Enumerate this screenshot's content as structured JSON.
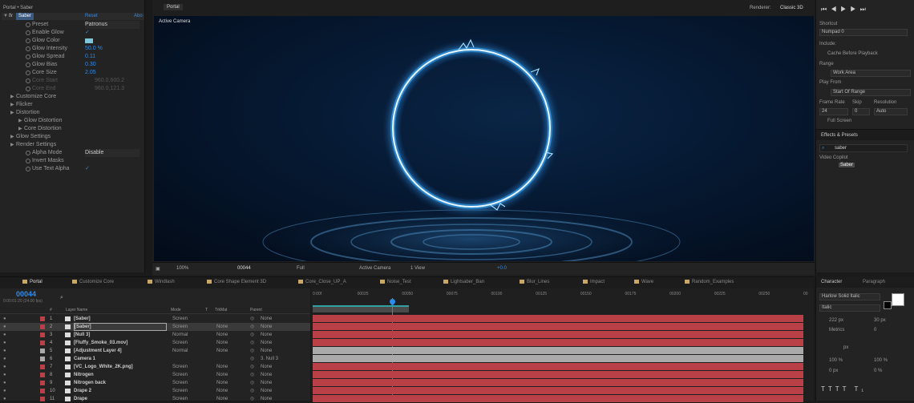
{
  "effect_controls": {
    "title": "Portal • Saber",
    "effect_name": "Saber",
    "reset": "Reset",
    "about": "Abo",
    "rows": [
      {
        "label": "Preset",
        "value": "Patronus",
        "kind": "dropdown"
      },
      {
        "label": "Enable Glow",
        "value": "✓"
      },
      {
        "label": "Glow Color",
        "value": ""
      },
      {
        "label": "Glow Intensity",
        "value": "50.0 %"
      },
      {
        "label": "Glow Spread",
        "value": "0.11"
      },
      {
        "label": "Glow Bias",
        "value": "0.30"
      },
      {
        "label": "Core Size",
        "value": "2.05"
      },
      {
        "label": "Core Start",
        "value": "960.0,600.2",
        "disabled": true
      },
      {
        "label": "Core End",
        "value": "960.0,121.3",
        "disabled": true
      },
      {
        "label": "Customize Core",
        "value": ""
      },
      {
        "label": "Flicker",
        "value": ""
      },
      {
        "label": "Distortion",
        "value": ""
      },
      {
        "label": "Glow Distortion",
        "value": ""
      },
      {
        "label": "Core Distortion",
        "value": ""
      },
      {
        "label": "Glow Settings",
        "value": ""
      },
      {
        "label": "Render Settings",
        "value": ""
      },
      {
        "label": "Alpha Mode",
        "value": "Disable",
        "kind": "dropdown"
      },
      {
        "label": "Invert Masks",
        "value": ""
      },
      {
        "label": "Use Text Alpha",
        "value": "✓"
      }
    ]
  },
  "viewer": {
    "tab": "Portal",
    "renderer_label": "Renderer:",
    "renderer_value": "Classic 3D",
    "camera_label": "Active Camera",
    "bottom_bar": {
      "zoom": "100%",
      "timecode": "00044",
      "resolution": "Full",
      "camera": "Active Camera",
      "views": "1 View",
      "exposure": "+0.0"
    }
  },
  "preview": {
    "shortcut_label": "Shortcut",
    "shortcut_value": "Numpad 0",
    "include_label": "Include:",
    "cache_label": "Cache Before Playback",
    "range_label": "Range",
    "range_value": "Work Area",
    "playfrom_label": "Play From",
    "playfrom_value": "Start Of Range",
    "framerate_label": "Frame Rate",
    "skip_label": "Skip",
    "resolution_label": "Resolution",
    "framerate_value": "24",
    "skip_value": "0",
    "resolution_value": "Auto",
    "fullscreen_label": "Full Screen"
  },
  "effects_presets": {
    "title": "Effects & Presets",
    "search": "saber",
    "category": "Video Copilot",
    "item": "Saber"
  },
  "comp_tabs": [
    "Portal",
    "Customize Core",
    "Windlash",
    "Core Shape Element 3D",
    "Core_Close_UP_A",
    "Noise_Test",
    "Lightsaber_Ban",
    "Blur_Lines",
    "Impact",
    "Wave",
    "Random_Examples"
  ],
  "timeline": {
    "timecode": "00044",
    "timecode_sub": "0:00:01:20 (24.00 fps)",
    "headers": {
      "num": "#",
      "layer_name": "Layer Name",
      "mode": "Mode",
      "t": "T",
      "trkmat": "TrkMat",
      "parent": "Parent"
    },
    "ruler": [
      "0:00f",
      "00025",
      "00050",
      "00075",
      "00100",
      "00125",
      "00150",
      "00175",
      "00200",
      "00225",
      "00250",
      "00"
    ],
    "layers": [
      {
        "num": "1",
        "name": "[Saber]",
        "mode": "Screen",
        "trkmat": "",
        "parent": "None",
        "color": "#b94046"
      },
      {
        "num": "2",
        "name": "[Saber]",
        "mode": "Screen",
        "trkmat": "None",
        "parent": "None",
        "color": "#b94046",
        "selected": true
      },
      {
        "num": "3",
        "name": "[Null 3]",
        "mode": "Normal",
        "trkmat": "None",
        "parent": "None",
        "color": "#b94046"
      },
      {
        "num": "4",
        "name": "[Fluffy_Smoke_03.mov]",
        "mode": "Screen",
        "trkmat": "None",
        "parent": "None",
        "color": "#b94046"
      },
      {
        "num": "5",
        "name": "[Adjustment Layer 4]",
        "mode": "Normal",
        "trkmat": "None",
        "parent": "None",
        "color": "#aaaaaa"
      },
      {
        "num": "6",
        "name": "Camera 1",
        "mode": "",
        "trkmat": "",
        "parent": "3. Null 3",
        "color": "#aaaaaa"
      },
      {
        "num": "7",
        "name": "[VC_Logo_White_2K.png]",
        "mode": "Screen",
        "trkmat": "None",
        "parent": "None",
        "color": "#b94046"
      },
      {
        "num": "8",
        "name": "Nitrogen",
        "mode": "Screen",
        "trkmat": "None",
        "parent": "None",
        "color": "#b94046"
      },
      {
        "num": "9",
        "name": "Nitrogen back",
        "mode": "Screen",
        "trkmat": "None",
        "parent": "None",
        "color": "#b94046"
      },
      {
        "num": "10",
        "name": "Drape 2",
        "mode": "Screen",
        "trkmat": "None",
        "parent": "None",
        "color": "#b94046"
      },
      {
        "num": "11",
        "name": "Drape",
        "mode": "Screen",
        "trkmat": "None",
        "parent": "None",
        "color": "#b94046"
      }
    ]
  },
  "character": {
    "tab_character": "Character",
    "tab_paragraph": "Paragraph",
    "font": "Harlow Solid Italic",
    "style": "Italic",
    "size": "222 px",
    "leading": "30 px",
    "kerning": "Metrics",
    "tracking": "0",
    "stroke_unit": "px",
    "vscale": "100 %",
    "hscale": "100 %",
    "baseline": "0 px",
    "tsume": "0 %"
  }
}
